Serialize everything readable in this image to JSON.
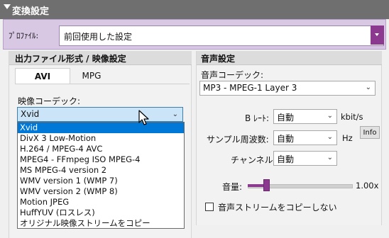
{
  "header": {
    "title": "変換設定"
  },
  "profile": {
    "label": "ﾌﾟﾛﾌｧｲﾙ:",
    "value": "前回使用した設定"
  },
  "left_panel": {
    "title": "出力ファイル形式 / 映像設定",
    "tabs": [
      "AVI",
      "MPG"
    ],
    "video_codec_label": "映像コーデック:",
    "video_codec_value": "Xvid",
    "codec_options": [
      "Xvid",
      "DivX 3 Low-Motion",
      "H.264 / MPEG-4 AVC",
      "MPEG4 - FFmpeg ISO MPEG-4",
      "MS MPEG-4 version 2",
      "WMV version 1 (WMP 7)",
      "WMV version 2 (WMP 8)",
      "Motion JPEG",
      "HuffYUV (ロスレス)",
      "オリジナル映像ストリームをコピー"
    ]
  },
  "right_panel": {
    "title": "音声設定",
    "audio_codec_label": "音声コーデック:",
    "audio_codec_value": "MP3 - MPEG-1 Layer 3",
    "bitrate": {
      "label": "B ﾚｰﾄ:",
      "value": "自動",
      "unit": "kbit/s"
    },
    "sample_rate": {
      "label": "サンプル周波数:",
      "value": "自動",
      "unit": "Hz"
    },
    "info_button": "Info",
    "channel": {
      "label": "チャンネル:",
      "value": "自動"
    },
    "volume": {
      "label": "音量:",
      "value": "1.00x",
      "fraction": 0.18
    },
    "copy_audio_label": "音声ストリームをコピーしない",
    "copy_audio_checked": false
  },
  "colors": {
    "accent": "#8b3a8f",
    "selection": "#0078d7",
    "header": "#6f6f6f",
    "profile_bg": "#d8c8e4"
  },
  "icons": [
    "collapse-triangle-icon",
    "dropdown-arrow-icon",
    "chevron-down-icon",
    "mouse-cursor-icon"
  ]
}
